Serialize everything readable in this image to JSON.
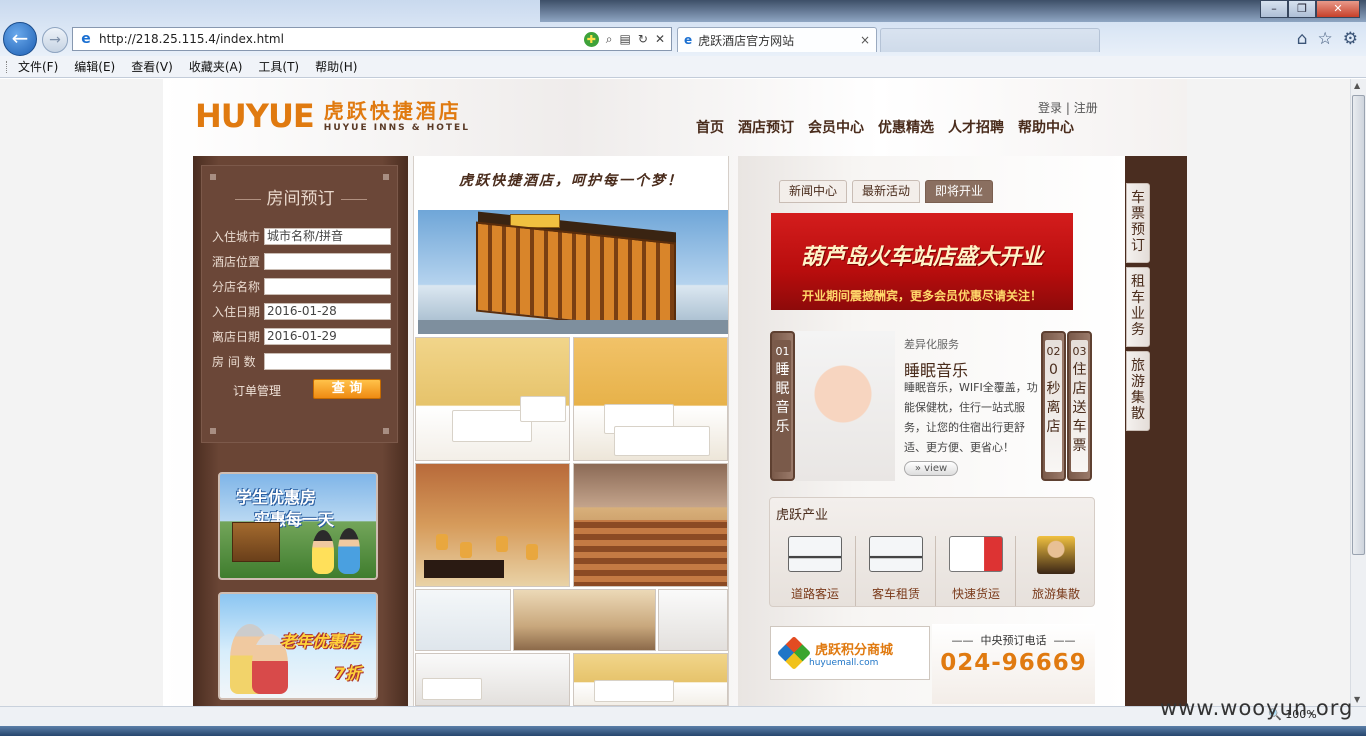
{
  "browser": {
    "url": "http://218.25.115.4/index.html",
    "tab_title": "虎跃酒店官方网站",
    "tab_close": "×",
    "back_icon": "←",
    "forward_icon": "→",
    "menu": [
      "文件(F)",
      "编辑(E)",
      "查看(V)",
      "收藏夹(A)",
      "工具(T)",
      "帮助(H)"
    ],
    "zoom": "100%"
  },
  "header": {
    "logo_en": "HUYUE",
    "logo_cn": "虎跃快捷酒店",
    "logo_sub": "HUYUE INNS & HOTEL",
    "login": "登录",
    "register": "注册",
    "nav": [
      "首页",
      "酒店预订",
      "会员中心",
      "优惠精选",
      "人才招聘",
      "帮助中心"
    ]
  },
  "booking": {
    "title": "房间预订",
    "fields": [
      {
        "label": "入住城市",
        "value": "城市名称/拼音"
      },
      {
        "label": "酒店位置",
        "value": ""
      },
      {
        "label": "分店名称",
        "value": ""
      },
      {
        "label": "入住日期",
        "value": "2016-01-28"
      },
      {
        "label": "离店日期",
        "value": "2016-01-29"
      },
      {
        "label": "房 间 数",
        "value": ""
      }
    ],
    "order_link": "订单管理",
    "search_button": "查 询"
  },
  "promos": {
    "student_line1": "学生优惠房",
    "student_line2": "实惠每一天",
    "senior_line1": "老年优惠房",
    "senior_line2": "7折"
  },
  "middle": {
    "slogan": "虎跃快捷酒店，呵护每一个梦！"
  },
  "news": {
    "tabs": [
      "新闻中心",
      "最新活动",
      "即将开业"
    ],
    "active_tab": "即将开业",
    "banner_title": "葫芦岛火车站店盛大开业",
    "banner_sub": "开业期间震撼酬宾，更多会员优惠尽请关注！"
  },
  "services": {
    "tab1_num": "01",
    "tab1_text": "睡眠音乐",
    "tab2_num": "02",
    "tab2_text": "0秒离店",
    "tab3_num": "03",
    "tab3_text": "住店送车票",
    "category": "差异化服务",
    "title": "睡眠音乐",
    "desc": "睡眠音乐，WIFI全覆盖，功能保健枕，住行一站式服务，让您的住宿出行更舒适、更方便、更省心！",
    "view": "view"
  },
  "industry": {
    "title": "虎跃产业",
    "items": [
      "道路客运",
      "客车租赁",
      "快速货运",
      "旅游集散"
    ]
  },
  "mall": {
    "name": "虎跃积分商城",
    "domain": "huyuemall.com"
  },
  "phone": {
    "label": "中央预订电话",
    "number": "024-96669"
  },
  "sidebar": [
    "车票预订",
    "租车业务",
    "旅游集散"
  ],
  "watermark": "www.wooyun.org"
}
